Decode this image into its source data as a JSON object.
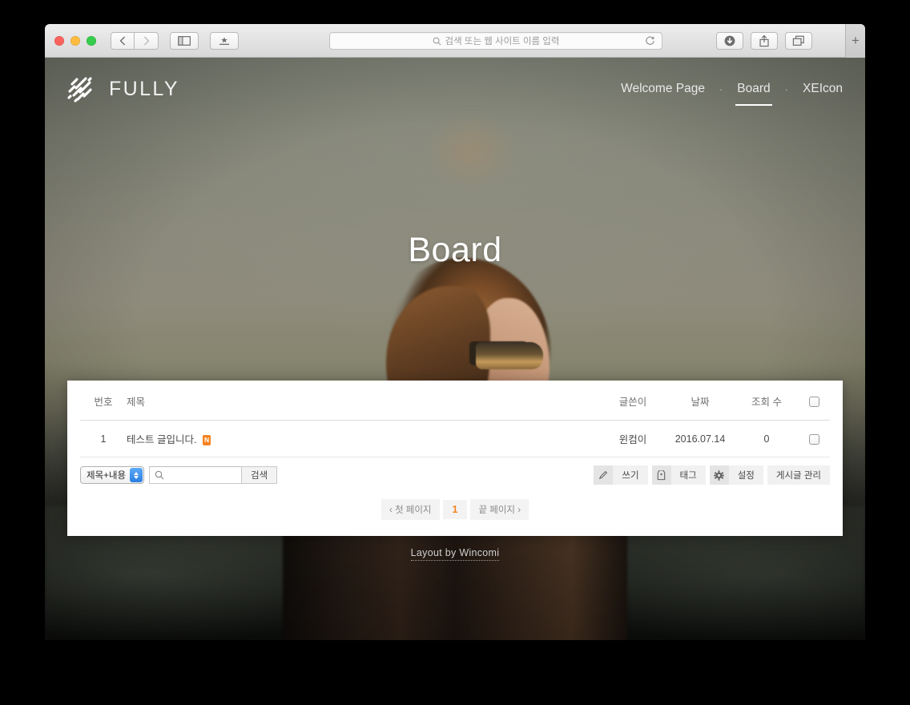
{
  "browser": {
    "window_controls": [
      "close",
      "minimize",
      "zoom"
    ],
    "nav_back_icon": "chevron-left-icon",
    "nav_forward_icon": "chevron-right-icon",
    "sidebar_icon": "sidebar-icon",
    "bookmarks_icon": "star-in-box-icon",
    "address": {
      "value": "",
      "placeholder": "검색 또는 웹 사이트 이름 입력",
      "search_icon": "search-icon",
      "reload_icon": "reload-icon"
    },
    "downloads_icon": "download-icon",
    "share_icon": "share-icon",
    "tab_overview_icon": "tab-overview-icon",
    "new_tab_label": "+"
  },
  "site": {
    "brand": "FULLY",
    "logo_icon": "diagonal-dashes-logo",
    "nav": [
      {
        "label": "Welcome Page",
        "active": false
      },
      {
        "label": "Board",
        "active": true
      },
      {
        "label": "XEIcon",
        "active": false
      }
    ],
    "nav_separator": "·",
    "hero_title": "Board",
    "footer_credit": "Layout by Wincomi"
  },
  "board": {
    "columns": {
      "no": "번호",
      "title": "제목",
      "author": "글쓴이",
      "date": "날짜",
      "hits": "조회 수"
    },
    "rows": [
      {
        "no": "1",
        "title": "테스트 글입니다.",
        "badge": "N",
        "author": "윈컴이",
        "date": "2016.07.14",
        "hits": "0"
      }
    ],
    "search": {
      "filter_selected": "제목+내용",
      "input_value": "",
      "input_placeholder": "",
      "search_icon": "search-icon",
      "submit_label": "검색"
    },
    "actions": [
      {
        "label": "쓰기",
        "icon": "pencil-icon"
      },
      {
        "label": "태그",
        "icon": "tag-icon"
      },
      {
        "label": "설정",
        "icon": "gear-icon"
      },
      {
        "label": "게시글 관리",
        "icon": ""
      }
    ],
    "pagination": {
      "first_label": "첫 페이지",
      "first_icon": "chevron-left-icon",
      "current_page": "1",
      "last_label": "끝 페이지",
      "last_icon": "chevron-right-icon"
    }
  },
  "colors": {
    "accent_orange": "#f58220",
    "panel_background": "#ffffff",
    "nav_text": "#e8e8e8",
    "select_stepper_blue": "#2a7fe0"
  }
}
